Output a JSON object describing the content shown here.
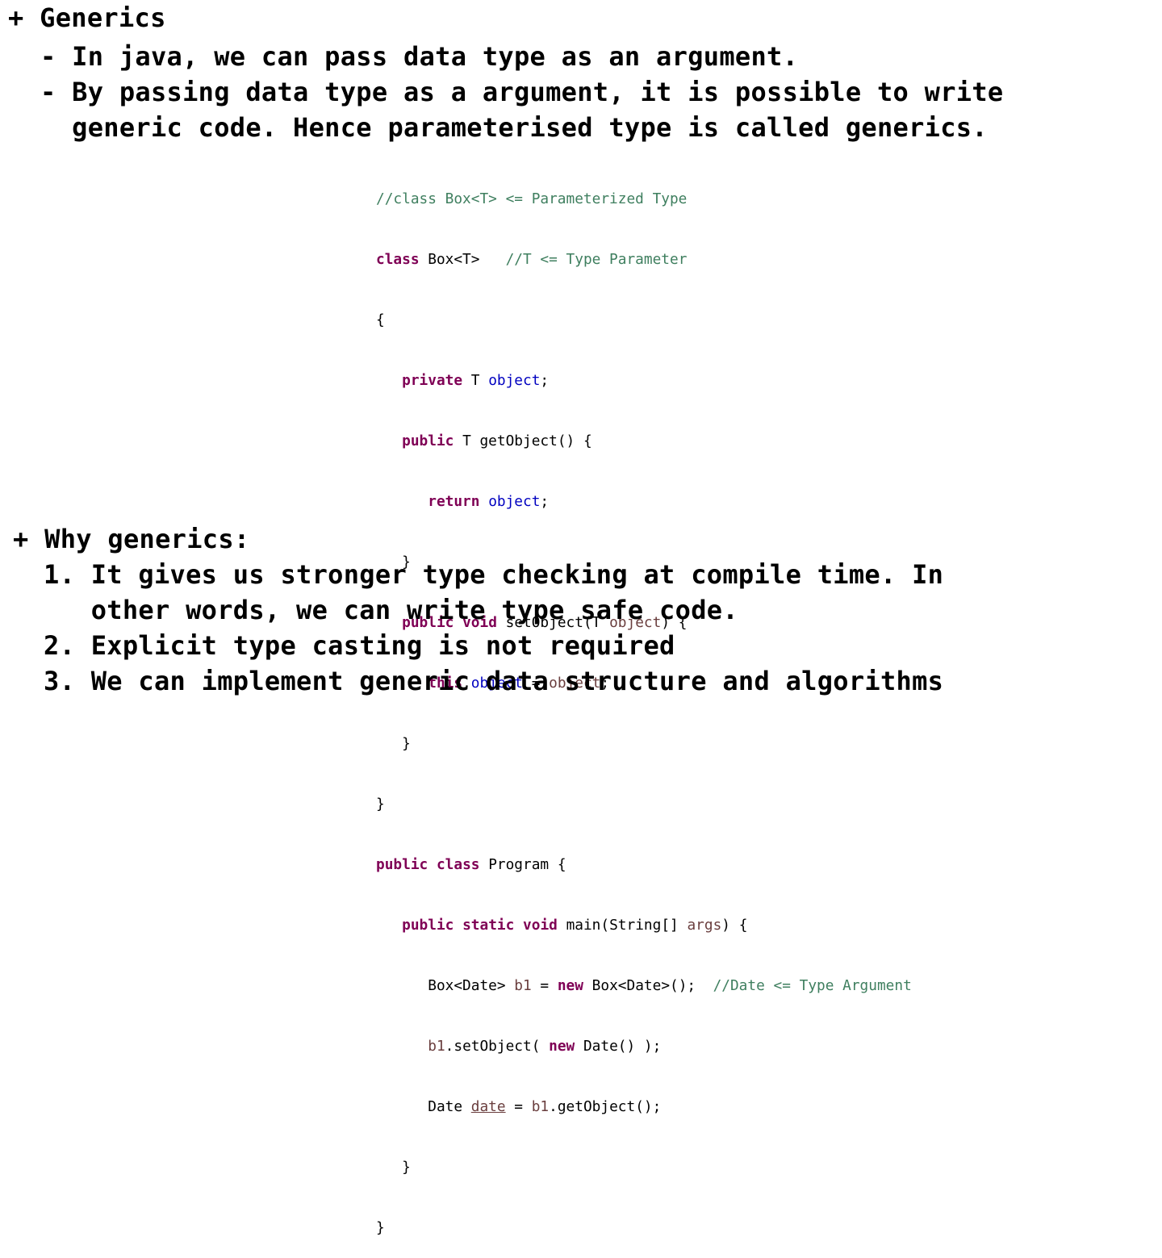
{
  "section1": {
    "heading": "+ Generics",
    "bullets": [
      "- In java, we can pass data type as an argument.",
      "- By passing data type as a argument, it is possible to write",
      "  generic code. Hence parameterised type is called generics."
    ]
  },
  "code_block": {
    "colors": {
      "keyword": "#7f0055",
      "comment": "#3f7f5f",
      "field": "#0000c0",
      "variable": "#6a3e3e"
    },
    "line_1_comment": "//class Box<T> <= Parameterized Type",
    "line_2_kw": "class",
    "line_2_text": " Box<T>   ",
    "line_2_comment": "//T <= Type Parameter",
    "line_3": "{",
    "line_4_kw": "private",
    "line_4_text": " T ",
    "line_4_field": "object",
    "line_4_end": ";",
    "line_5_kw": "public",
    "line_5_text": " T getObject() {",
    "line_6_kw": "return",
    "line_6_field": "object",
    "line_6_end": ";",
    "line_7": "}",
    "line_8_kw1": "public",
    "line_8_kw2": "void",
    "line_8_text": " setObject(T ",
    "line_8_var": "object",
    "line_8_end": ") {",
    "line_9_kw": "this",
    "line_9_dot": ".",
    "line_9_field": "object",
    "line_9_eq": " = ",
    "line_9_var": "object",
    "line_9_end": ";",
    "line_10": "}",
    "line_11": "}",
    "line_12_kw1": "public",
    "line_12_kw2": "class",
    "line_12_text": " Program {",
    "line_13_kw1": "public",
    "line_13_kw2": "static",
    "line_13_kw3": "void",
    "line_13_text": " main(String[] ",
    "line_13_var": "args",
    "line_13_end": ") {",
    "line_14_text": "Box<Date> ",
    "line_14_var": "b1",
    "line_14_eq": " = ",
    "line_14_kw": "new",
    "line_14_rest": " Box<Date>();  ",
    "line_14_comment": "//Date <= Type Argument",
    "line_15_var": "b1",
    "line_15_text": ".setObject( ",
    "line_15_kw": "new",
    "line_15_end": " Date() );",
    "line_16_text": "Date ",
    "line_16_var": "date",
    "line_16_eq": " = ",
    "line_16_var2": "b1",
    "line_16_end": ".getObject();",
    "line_17": "}",
    "line_18": "}"
  },
  "section2": {
    "heading": "+ Why generics:",
    "items": [
      "1. It gives us stronger type checking at compile time. In",
      "   other words, we can write type safe code.",
      "2. Explicit type casting is not required",
      "3. We can implement generic data structure and algorithms"
    ]
  }
}
